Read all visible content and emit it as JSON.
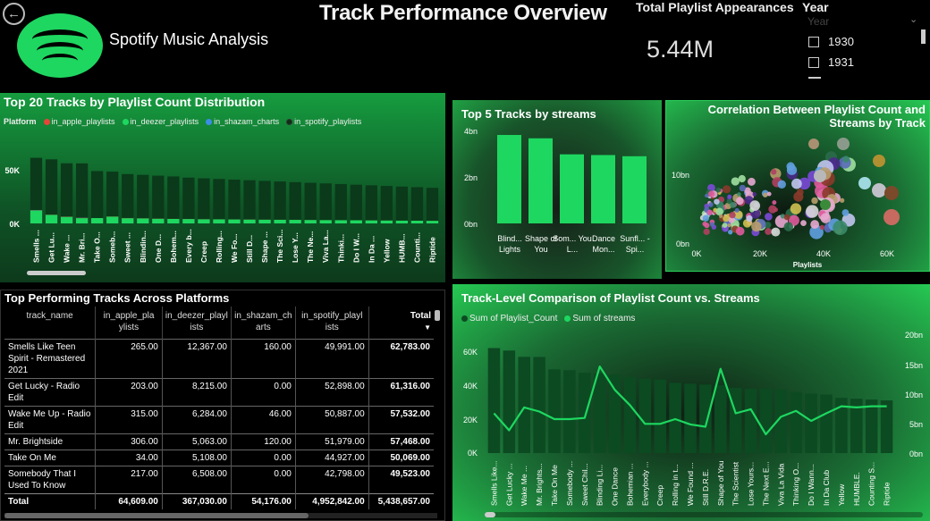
{
  "header": {
    "title": "Track Performance Overview",
    "brand": "Spotify Music Analysis",
    "kpi_label": "Total Playlist Appearances",
    "kpi_value": "5.44M",
    "back_icon": "back-arrow-icon",
    "logo_icon": "spotify-logo"
  },
  "slicer": {
    "title": "Year",
    "header": "Year",
    "items": [
      "1930",
      "1931"
    ]
  },
  "colors": {
    "apple": "#e8443a",
    "deezer": "#1ed760",
    "shazam": "#3a8ee6",
    "spotify": "#0c2e16",
    "bar_light": "#1ed760",
    "bar_dark": "#0a3a1a"
  },
  "top20": {
    "title": "Top 20 Tracks by Playlist Count Distribution",
    "legend_title": "Platform",
    "legend": [
      "in_apple_playlists",
      "in_deezer_playlists",
      "in_shazam_charts",
      "in_spotify_playlists"
    ],
    "chart_data": {
      "type": "bar",
      "stacked": true,
      "ylabels": [
        "50K",
        "0K"
      ],
      "categories": [
        "Smells ...",
        "Get Lu...",
        "Wake ...",
        "Mr. Bri...",
        "Take O...",
        "Someb...",
        "Sweet ...",
        "Blindin...",
        "One D...",
        "Bohem...",
        "Every b...",
        "Creep",
        "Rolling...",
        "We Fo...",
        "Still D...",
        "Shape ...",
        "The Sci...",
        "Lose Y...",
        "The Ne...",
        "Viva La...",
        "Thinki...",
        "Do I W...",
        "In Da ...",
        "Yellow",
        "HUMB...",
        "Counti...",
        "Riptide"
      ],
      "series": [
        {
          "name": "in_apple_playlists",
          "values": [
            265,
            203,
            315,
            306,
            34,
            217,
            200,
            180,
            150,
            140,
            130,
            120,
            110,
            100,
            100,
            90,
            90,
            80,
            80,
            70,
            70,
            60,
            60,
            60,
            50,
            50,
            50
          ]
        },
        {
          "name": "in_deezer_playlists",
          "values": [
            12367,
            8215,
            6284,
            5063,
            5108,
            6508,
            5000,
            4800,
            4500,
            4300,
            4200,
            4000,
            3900,
            3800,
            3700,
            3600,
            3500,
            3400,
            3300,
            3200,
            3100,
            3000,
            2900,
            2800,
            2700,
            2600,
            2500
          ]
        },
        {
          "name": "in_shazam_charts",
          "values": [
            160,
            0,
            46,
            120,
            0,
            0,
            0,
            0,
            0,
            0,
            0,
            0,
            0,
            0,
            0,
            0,
            0,
            0,
            0,
            0,
            0,
            0,
            0,
            0,
            0,
            0,
            0
          ]
        },
        {
          "name": "in_spotify_playlists",
          "values": [
            49991,
            52898,
            50887,
            51979,
            44927,
            42798,
            42000,
            41500,
            41000,
            40500,
            39500,
            39000,
            38500,
            38000,
            37500,
            37000,
            36500,
            36000,
            35500,
            35000,
            34500,
            34000,
            33500,
            33000,
            32500,
            32000,
            31500
          ]
        }
      ],
      "ylim": [
        0,
        65000
      ]
    }
  },
  "top5": {
    "title": "Top 5 Tracks by streams",
    "chart_data": {
      "type": "bar",
      "categories": [
        "Blind... Lights",
        "Shape of You",
        "Som... You L...",
        "Dance Mon...",
        "Sunfl... - Spi..."
      ],
      "values": [
        3.7,
        3.56,
        2.89,
        2.86,
        2.81
      ],
      "ylabels": [
        "4bn",
        "2bn",
        "0bn"
      ],
      "ylim": [
        0,
        4.2
      ]
    }
  },
  "correlation": {
    "title_line1": "Correlation Between Playlist Count and",
    "title_line2": "Streams by Track",
    "chart_data": {
      "type": "scatter",
      "xlabel": "Playlists",
      "xticks": [
        "0K",
        "20K",
        "40K",
        "60K"
      ],
      "yticks": [
        "10bn",
        "0bn"
      ],
      "xlim": [
        0,
        70000
      ],
      "ylim": [
        0,
        17000000000
      ]
    }
  },
  "table": {
    "title": "Top Performing Tracks Across Platforms",
    "columns": [
      "track_name",
      "in_apple_pla ylists",
      "in_deezer_playl ists",
      "in_shazam_ch arts",
      "in_spotify_playl ists",
      "Total"
    ],
    "rows": [
      [
        "Smells Like Teen Spirit - Remastered 2021",
        "265.00",
        "12,367.00",
        "160.00",
        "49,991.00",
        "62,783.00"
      ],
      [
        "Get Lucky - Radio Edit",
        "203.00",
        "8,215.00",
        "0.00",
        "52,898.00",
        "61,316.00"
      ],
      [
        "Wake Me Up - Radio Edit",
        "315.00",
        "6,284.00",
        "46.00",
        "50,887.00",
        "57,532.00"
      ],
      [
        "Mr. Brightside",
        "306.00",
        "5,063.00",
        "120.00",
        "51,979.00",
        "57,468.00"
      ],
      [
        "Take On Me",
        "34.00",
        "5,108.00",
        "0.00",
        "44,927.00",
        "50,069.00"
      ],
      [
        "Somebody That I Used To Know",
        "217.00",
        "6,508.00",
        "0.00",
        "42,798.00",
        "49,523.00"
      ]
    ],
    "total": [
      "Total",
      "64,609.00",
      "367,030.00",
      "54,176.00",
      "4,952,842.00",
      "5,438,657.00"
    ],
    "sort_icon": "sort-desc-icon"
  },
  "combo": {
    "title": "Track-Level Comparison of Playlist Count vs. Streams",
    "legend": [
      "Sum of Playlist_Count",
      "Sum of streams"
    ],
    "chart_data": {
      "type": "bar",
      "categories": [
        "Smells Like...",
        "Get Lucky ...",
        "Wake Me ...",
        "Mr. Brights...",
        "Take On Me",
        "Somebody ...",
        "Sweet Chil...",
        "Blinding Li...",
        "One Dance",
        "Bohemian ...",
        "Everybody ...",
        "Creep",
        "Rolling in t...",
        "We Found ...",
        "Still D.R.E.",
        "Shape of You",
        "The Scientist",
        "Lose Yours...",
        "The Next E...",
        "Viva La Vida",
        "Thinking O...",
        "Do I Wann...",
        "In Da Club",
        "Yellow",
        "HUMBLE.",
        "Counting S...",
        "Riptide"
      ],
      "series": [
        {
          "name": "Sum of Playlist_Count",
          "values": [
            62783,
            61316,
            57532,
            57468,
            50069,
            49523,
            48000,
            47500,
            47000,
            45500,
            44500,
            44000,
            42000,
            41500,
            41000,
            40500,
            39000,
            38500,
            38500,
            38000,
            36500,
            35500,
            35000,
            33000,
            32500,
            32000,
            31500
          ]
        },
        {
          "name": "Sum of streams",
          "values": [
            6.8,
            3.9,
            7.8,
            7.1,
            5.8,
            5.8,
            6.0,
            14.8,
            10.8,
            8.2,
            5.0,
            5.0,
            5.8,
            4.9,
            4.5,
            14.4,
            6.8,
            7.5,
            3.2,
            6.2,
            7.2,
            5.5,
            6.8,
            8.0,
            7.8,
            8.0,
            8.0
          ]
        }
      ],
      "yticks_left": [
        "60K",
        "40K",
        "20K",
        "0K"
      ],
      "yticks_right": [
        "20bn",
        "15bn",
        "10bn",
        "5bn",
        "0bn"
      ],
      "ylim_left": [
        0,
        70000
      ],
      "ylim_right": [
        0,
        20
      ]
    }
  }
}
